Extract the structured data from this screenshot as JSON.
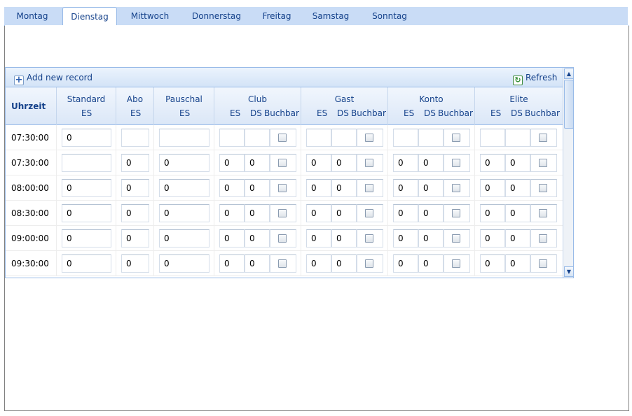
{
  "tabs": [
    "Montag",
    "Dienstag",
    "Mittwoch",
    "Donnerstag",
    "Freitag",
    "Samstag",
    "Sonntag"
  ],
  "active_tab": "Dienstag",
  "toolbar": {
    "add_label": "Add new record",
    "refresh_label": "Refresh"
  },
  "columns": {
    "uhrzeit": "Uhrzeit",
    "standard": {
      "title": "Standard",
      "es": "ES"
    },
    "abo": {
      "title": "Abo",
      "es": "ES"
    },
    "pauschal": {
      "title": "Pauschal",
      "es": "ES"
    },
    "club": {
      "title": "Club",
      "es": "ES",
      "ds": "DS",
      "buchbar": "Buchbar"
    },
    "gast": {
      "title": "Gast",
      "es": "ES",
      "ds": "DS",
      "buchbar": "Buchbar"
    },
    "konto": {
      "title": "Konto",
      "es": "ES",
      "ds": "DS",
      "buchbar": "Buchbar"
    },
    "elite": {
      "title": "Elite",
      "es": "ES",
      "ds": "DS",
      "buchbar": "Buchbar"
    }
  },
  "rows": [
    {
      "time": "07:30:00",
      "standard": "0",
      "abo": "",
      "pauschal": "",
      "club_es": "",
      "club_ds": "",
      "gast_es": "",
      "gast_ds": "",
      "konto_es": "",
      "konto_ds": "",
      "elite_es": "",
      "elite_ds": ""
    },
    {
      "time": "07:30:00",
      "standard": "",
      "abo": "0",
      "pauschal": "0",
      "club_es": "0",
      "club_ds": "0",
      "gast_es": "0",
      "gast_ds": "0",
      "konto_es": "0",
      "konto_ds": "0",
      "elite_es": "0",
      "elite_ds": "0"
    },
    {
      "time": "08:00:00",
      "standard": "0",
      "abo": "0",
      "pauschal": "0",
      "club_es": "0",
      "club_ds": "0",
      "gast_es": "0",
      "gast_ds": "0",
      "konto_es": "0",
      "konto_ds": "0",
      "elite_es": "0",
      "elite_ds": "0"
    },
    {
      "time": "08:30:00",
      "standard": "0",
      "abo": "0",
      "pauschal": "0",
      "club_es": "0",
      "club_ds": "0",
      "gast_es": "0",
      "gast_ds": "0",
      "konto_es": "0",
      "konto_ds": "0",
      "elite_es": "0",
      "elite_ds": "0"
    },
    {
      "time": "09:00:00",
      "standard": "0",
      "abo": "0",
      "pauschal": "0",
      "club_es": "0",
      "club_ds": "0",
      "gast_es": "0",
      "gast_ds": "0",
      "konto_es": "0",
      "konto_ds": "0",
      "elite_es": "0",
      "elite_ds": "0"
    },
    {
      "time": "09:30:00",
      "standard": "0",
      "abo": "0",
      "pauschal": "0",
      "club_es": "0",
      "club_ds": "0",
      "gast_es": "0",
      "gast_ds": "0",
      "konto_es": "0",
      "konto_ds": "0",
      "elite_es": "0",
      "elite_ds": "0"
    }
  ],
  "colors": {
    "accent": "#15428b",
    "header_bg": "#dbe7f7",
    "border": "#99bbe8",
    "tabbar_bg": "#c9dcf6"
  }
}
